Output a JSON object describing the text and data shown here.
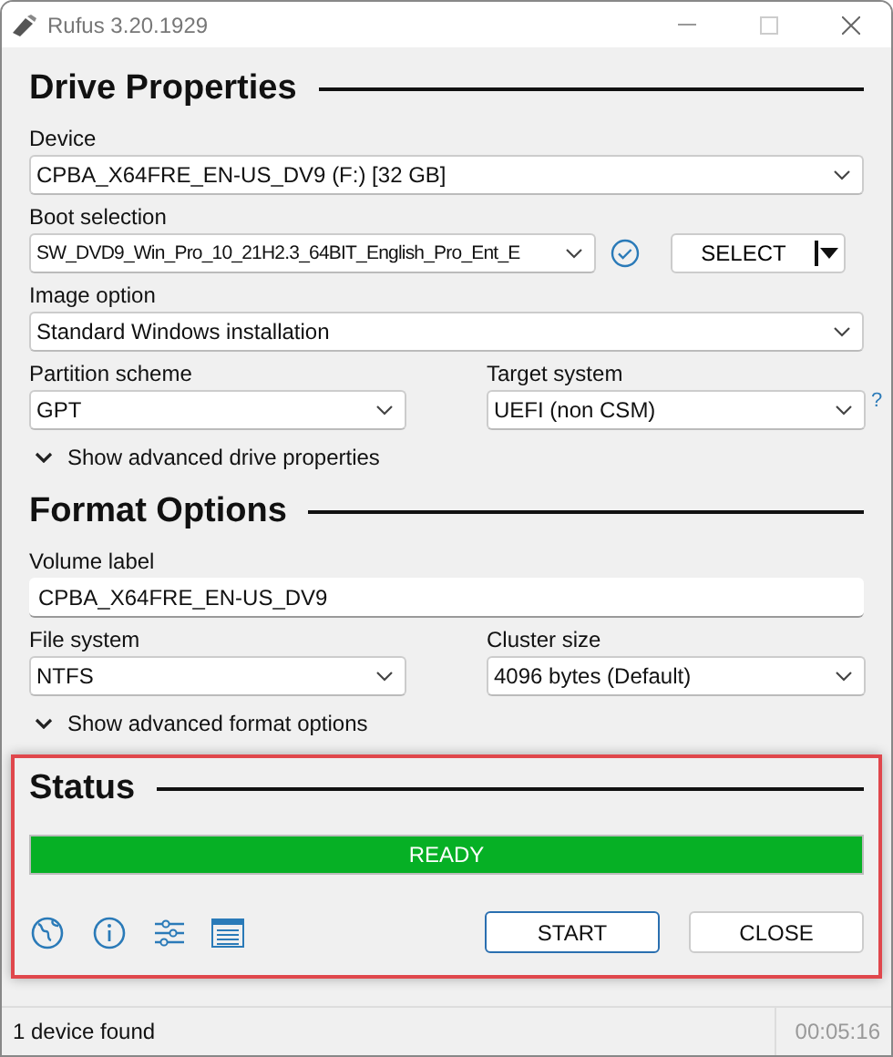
{
  "window": {
    "title": "Rufus 3.20.1929"
  },
  "drive_properties": {
    "heading": "Drive Properties",
    "device": {
      "label": "Device",
      "value": "CPBA_X64FRE_EN-US_DV9 (F:) [32 GB]"
    },
    "boot_selection": {
      "label": "Boot selection",
      "value": "SW_DVD9_Win_Pro_10_21H2.3_64BIT_English_Pro_Ent_E",
      "button": "SELECT"
    },
    "image_option": {
      "label": "Image option",
      "value": "Standard Windows installation"
    },
    "partition_scheme": {
      "label": "Partition scheme",
      "value": "GPT"
    },
    "target_system": {
      "label": "Target system",
      "value": "UEFI (non CSM)",
      "help": "?"
    },
    "advanced_toggle": {
      "label": "Show advanced drive properties",
      "expanded": false
    }
  },
  "format_options": {
    "heading": "Format Options",
    "volume_label": {
      "label": "Volume label",
      "value": "CPBA_X64FRE_EN-US_DV9"
    },
    "file_system": {
      "label": "File system",
      "value": "NTFS"
    },
    "cluster_size": {
      "label": "Cluster size",
      "value": "4096 bytes (Default)"
    },
    "advanced_toggle": {
      "label": "Show advanced format options",
      "expanded": false
    }
  },
  "status": {
    "heading": "Status",
    "highlighted": true,
    "progress": {
      "text": "READY",
      "level": 1
    },
    "buttons": [
      {
        "label": "START",
        "default": true
      },
      {
        "label": "CLOSE",
        "default": false
      }
    ]
  },
  "status_bar": {
    "message": "1 device found",
    "timer": "00:05:16"
  }
}
